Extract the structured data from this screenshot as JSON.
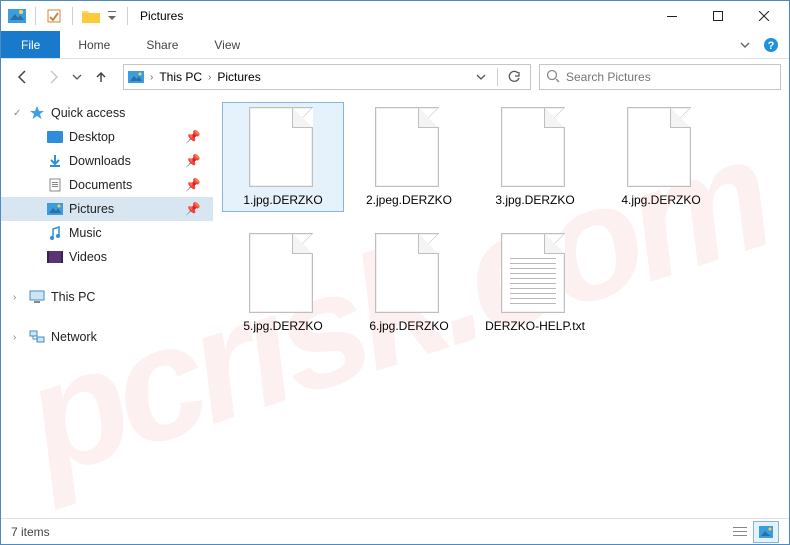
{
  "titlebar": {
    "title": "Pictures"
  },
  "window_controls": {
    "minimize": "—",
    "maximize": "☐",
    "close": "✕"
  },
  "ribbon": {
    "file": "File",
    "tabs": [
      "Home",
      "Share",
      "View"
    ]
  },
  "nav": {
    "breadcrumb": [
      "This PC",
      "Pictures"
    ]
  },
  "search": {
    "placeholder": "Search Pictures"
  },
  "tree": {
    "quick_access": {
      "label": "Quick access"
    },
    "items": [
      {
        "label": "Desktop",
        "pinned": true
      },
      {
        "label": "Downloads",
        "pinned": true
      },
      {
        "label": "Documents",
        "pinned": true
      },
      {
        "label": "Pictures",
        "pinned": true,
        "selected": true
      },
      {
        "label": "Music",
        "pinned": false
      },
      {
        "label": "Videos",
        "pinned": false
      }
    ],
    "this_pc": {
      "label": "This PC"
    },
    "network": {
      "label": "Network"
    }
  },
  "files": [
    {
      "name": "1.jpg.DERZKO",
      "type": "generic",
      "selected": true
    },
    {
      "name": "2.jpeg.DERZKO",
      "type": "generic"
    },
    {
      "name": "3.jpg.DERZKO",
      "type": "generic"
    },
    {
      "name": "4.jpg.DERZKO",
      "type": "generic"
    },
    {
      "name": "5.jpg.DERZKO",
      "type": "generic"
    },
    {
      "name": "6.jpg.DERZKO",
      "type": "generic"
    },
    {
      "name": "DERZKO-HELP.txt",
      "type": "txt"
    }
  ],
  "status": {
    "count_label": "7 items"
  },
  "watermark": "pcrisk.com"
}
